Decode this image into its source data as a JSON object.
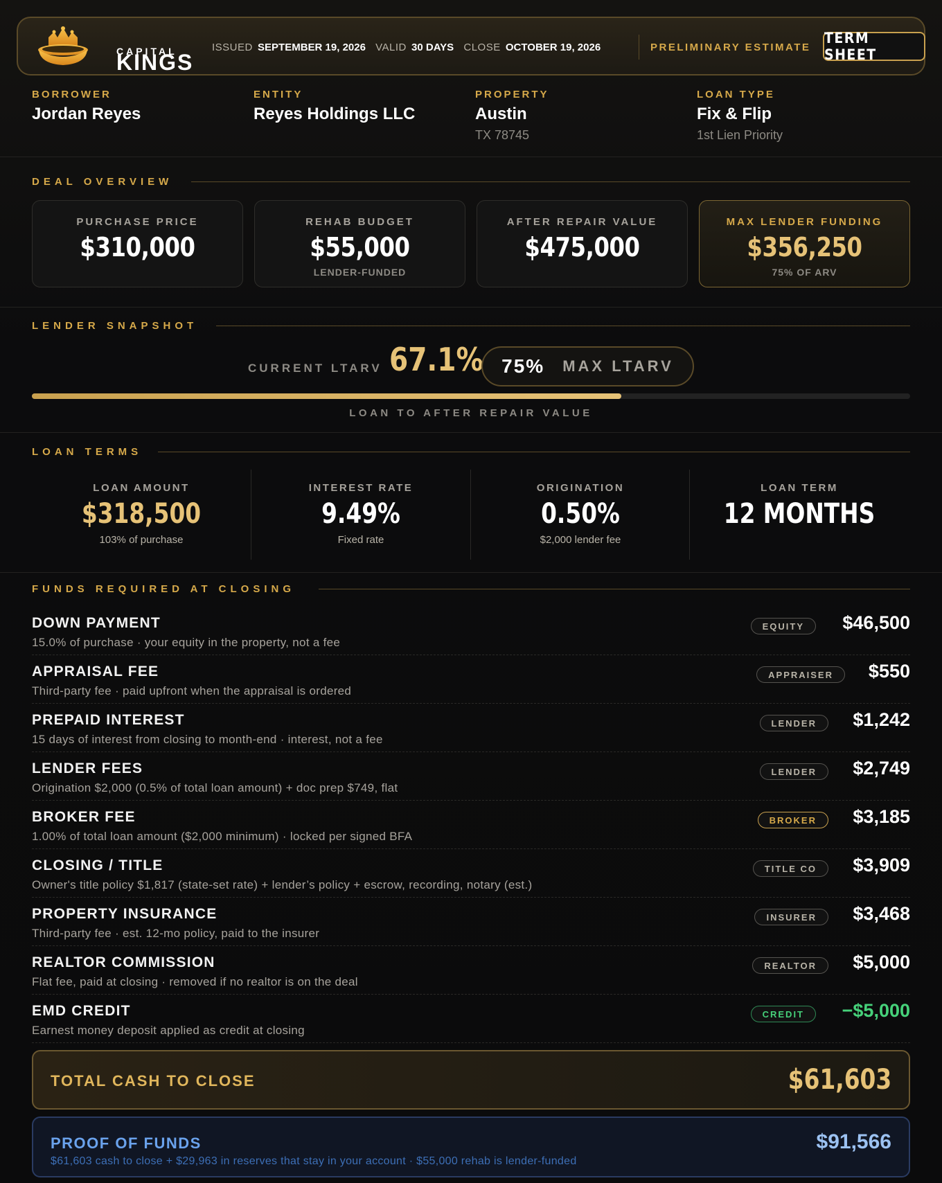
{
  "brand": {
    "capital": "CAPITAL",
    "kings": "KINGS"
  },
  "header": {
    "issued_label": "ISSUED",
    "issued": "SEPTEMBER 19, 2026",
    "valid_label": "VALID",
    "valid": "30 DAYS",
    "close_label": "CLOSE",
    "close": "OCTOBER 19, 2026",
    "status": "PRELIMINARY ESTIMATE",
    "term_sheet_button": "TERM SHEET"
  },
  "info": {
    "borrower_label": "BORROWER",
    "borrower": "Jordan Reyes",
    "entity_label": "ENTITY",
    "entity": "Reyes Holdings LLC",
    "property_label": "PROPERTY",
    "property_city": "Austin",
    "property_zip": "TX 78745",
    "loan_type_label": "LOAN TYPE",
    "loan_type": "Fix & Flip",
    "lien": "1st Lien Priority"
  },
  "deal": {
    "title": "DEAL OVERVIEW",
    "cards": [
      {
        "label": "PURCHASE PRICE",
        "value": "$310,000",
        "sub": ""
      },
      {
        "label": "REHAB BUDGET",
        "value": "$55,000",
        "sub": "LENDER-FUNDED"
      },
      {
        "label": "AFTER REPAIR VALUE",
        "value": "$475,000",
        "sub": ""
      },
      {
        "label": "MAX LENDER FUNDING",
        "value": "$356,250",
        "sub": "75% OF ARV"
      }
    ]
  },
  "snapshot": {
    "title": "LENDER SNAPSHOT",
    "current_label": "CURRENT LTARV",
    "current_value": "67.1%",
    "max_value": "75%",
    "max_label": "MAX LTARV",
    "bar_fraction": 0.671,
    "caption": "LOAN TO AFTER REPAIR VALUE"
  },
  "terms": {
    "title": "LOAN TERMS",
    "items": [
      {
        "label": "LOAN AMOUNT",
        "value": "$318,500",
        "sub": "103% of purchase"
      },
      {
        "label": "INTEREST RATE",
        "value": "9.49%",
        "sub": "Fixed rate"
      },
      {
        "label": "ORIGINATION",
        "value": "0.50%",
        "sub": "$2,000 lender fee"
      },
      {
        "label": "LOAN TERM",
        "value": "12 MONTHS",
        "sub": ""
      }
    ]
  },
  "funds": {
    "title": "FUNDS REQUIRED AT CLOSING",
    "rows": [
      {
        "name": "DOWN PAYMENT",
        "desc": "15.0% of purchase · your equity in the property, not a fee",
        "badge": "EQUITY",
        "amount": "$46,500"
      },
      {
        "name": "APPRAISAL FEE",
        "desc": "Third-party fee · paid upfront when the appraisal is ordered",
        "badge": "APPRAISER",
        "amount": "$550"
      },
      {
        "name": "PREPAID INTEREST",
        "desc": "15 days of interest from closing to month-end · interest, not a fee",
        "badge": "LENDER",
        "amount": "$1,242"
      },
      {
        "name": "LENDER FEES",
        "desc": "Origination $2,000 (0.5% of total loan amount) + doc prep $749, flat",
        "badge": "LENDER",
        "amount": "$2,749"
      },
      {
        "name": "BROKER FEE",
        "desc": "1.00% of total loan amount ($2,000 minimum) · locked per signed BFA",
        "badge": "BROKER",
        "amount": "$3,185"
      },
      {
        "name": "CLOSING / TITLE",
        "desc": "Owner's title policy $1,817 (state-set rate) + lender’s policy + escrow, recording, notary (est.)",
        "badge": "TITLE CO",
        "amount": "$3,909"
      },
      {
        "name": "PROPERTY INSURANCE",
        "desc": "Third-party fee · est. 12-mo policy, paid to the insurer",
        "badge": "INSURER",
        "amount": "$3,468"
      },
      {
        "name": "REALTOR COMMISSION",
        "desc": "Flat fee, paid at closing · removed if no realtor is on the deal",
        "badge": "REALTOR",
        "amount": "$5,000"
      },
      {
        "name": "EMD CREDIT",
        "desc": "Earnest money deposit applied as credit at closing",
        "badge": "CREDIT",
        "amount": "−$5,000"
      }
    ],
    "total_label": "TOTAL CASH TO CLOSE",
    "total_value": "$61,603",
    "proof_label": "PROOF OF FUNDS",
    "proof_desc": "$61,603 cash to close + $29,963 in reserves that stay in your account · $55,000 rehab is lender-funded",
    "proof_value": "$91,566"
  },
  "colors": {
    "gold": "#d6a94a",
    "gold_light": "#e6c277",
    "green": "#46d17a",
    "blue": "#6aa2ec",
    "background": "#0b0b0c"
  }
}
